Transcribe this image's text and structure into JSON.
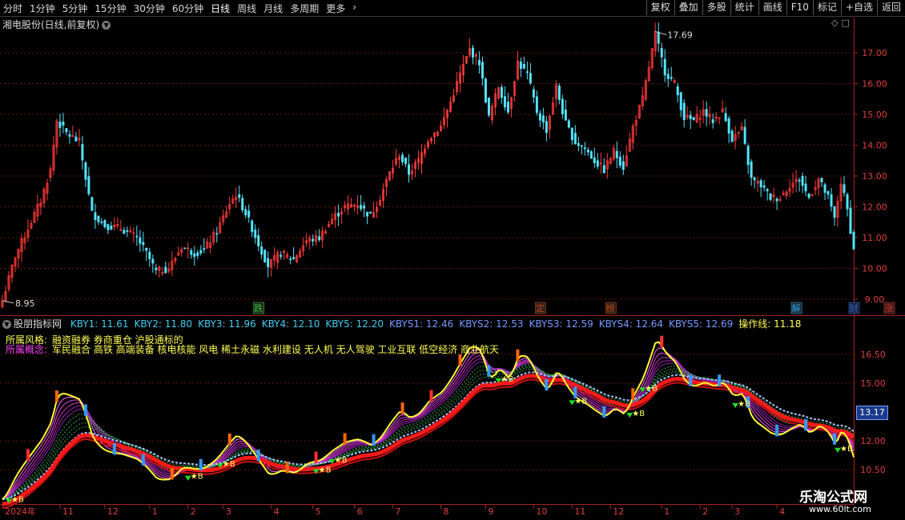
{
  "toolbar": {
    "periods": [
      "分时",
      "1分钟",
      "5分钟",
      "15分钟",
      "30分钟",
      "60分钟",
      "日线",
      "周线",
      "月线",
      "多周期",
      "更多"
    ],
    "active_period": "日线",
    "more_icon": "chevron-right-icon",
    "tools": [
      "复权",
      "叠加",
      "多股",
      "统计",
      "画线",
      "F10",
      "标记",
      "+自选",
      "返回"
    ]
  },
  "main_chart": {
    "title": "湘电股份(日线,前复权)",
    "high_label": "17.69",
    "low_label": "8.95",
    "price_ticks": [
      "17.00",
      "16.00",
      "15.00",
      "14.00",
      "13.00",
      "12.00",
      "11.00",
      "10.00",
      "9.00"
    ],
    "markers": [
      {
        "text": "跌",
        "x": 80,
        "color": "#33cc33"
      },
      {
        "text": "定",
        "x": 168,
        "color": "#cc4400"
      },
      {
        "text": "榜",
        "x": 190,
        "color": "#cc4400"
      },
      {
        "text": "解",
        "x": 248,
        "color": "#22aaee"
      },
      {
        "text": "财",
        "x": 266,
        "color": "#2266ee"
      },
      {
        "text": "涨",
        "x": 277,
        "color": "#ee2222"
      }
    ]
  },
  "indicator": {
    "name": "股朋指标网",
    "values": [
      {
        "text": "KBY1: 11.61",
        "color": "#44ccee"
      },
      {
        "text": "KBY2: 11.80",
        "color": "#44ccee"
      },
      {
        "text": "KBY3: 11.96",
        "color": "#44ccee"
      },
      {
        "text": "KBY4: 12.10",
        "color": "#44ccee"
      },
      {
        "text": "KBY5: 12.20",
        "color": "#44ccee"
      },
      {
        "text": "KBYS1: 12.46",
        "color": "#7799ff"
      },
      {
        "text": "KBYS2: 12.53",
        "color": "#7799ff"
      },
      {
        "text": "KBYS3: 12.59",
        "color": "#7799ff"
      },
      {
        "text": "KBYS4: 12.64",
        "color": "#7799ff"
      },
      {
        "text": "KBYS5: 12.69",
        "color": "#7799ff"
      },
      {
        "text": "操作线: 11.18",
        "color": "#ffff55"
      }
    ],
    "style_label": "所属风格:",
    "style_text": "融资融券 券商重仓 沪股通标的",
    "concept_label": "所属概念:",
    "concept_text": "军民融合 高铁 高端装备 核电核能 风电 稀土永磁 水利建设 无人机 无人驾驶 工业互联 低空经济 商业航天",
    "price_ticks": [
      "16.50",
      "15.00",
      "12.00",
      "10.50"
    ],
    "current_price": "13.17"
  },
  "x_axis": {
    "labels": [
      {
        "text": "2024年",
        "x": 0
      },
      {
        "text": "11",
        "x": 18
      },
      {
        "text": "12",
        "x": 32
      },
      {
        "text": "1",
        "x": 46
      },
      {
        "text": "2",
        "x": 58
      },
      {
        "text": "3",
        "x": 69
      },
      {
        "text": "4",
        "x": 84
      },
      {
        "text": "5",
        "x": 97
      },
      {
        "text": "6",
        "x": 110
      },
      {
        "text": "7",
        "x": 122
      },
      {
        "text": "8",
        "x": 137
      },
      {
        "text": "9",
        "x": 151
      },
      {
        "text": "10",
        "x": 166
      },
      {
        "text": "11",
        "x": 178
      },
      {
        "text": "12",
        "x": 190
      },
      {
        "text": "1",
        "x": 206
      },
      {
        "text": "2",
        "x": 218
      },
      {
        "text": "3",
        "x": 228
      },
      {
        "text": "4",
        "x": 242
      }
    ]
  },
  "watermark": {
    "title": "乐淘公式网",
    "url": "www.60lt.com"
  },
  "chart_data": {
    "type": "candlestick",
    "title": "湘电股份(日线,前复权)",
    "ylim": [
      8.7,
      18.2
    ],
    "annotations": {
      "max": 17.69,
      "min": 8.95
    },
    "close_keyframes": [
      [
        0,
        8.95
      ],
      [
        4,
        10.4
      ],
      [
        8,
        11.3
      ],
      [
        12,
        12.2
      ],
      [
        15,
        13.2
      ],
      [
        17,
        14.8
      ],
      [
        20,
        14.4
      ],
      [
        24,
        14.1
      ],
      [
        28,
        11.8
      ],
      [
        32,
        11.4
      ],
      [
        37,
        11.3
      ],
      [
        42,
        11.0
      ],
      [
        45,
        10.5
      ],
      [
        48,
        9.9
      ],
      [
        52,
        10.0
      ],
      [
        56,
        10.7
      ],
      [
        60,
        10.5
      ],
      [
        63,
        10.6
      ],
      [
        67,
        11.2
      ],
      [
        71,
        12.1
      ],
      [
        73,
        12.4
      ],
      [
        76,
        11.8
      ],
      [
        80,
        10.8
      ],
      [
        83,
        10.1
      ],
      [
        87,
        10.5
      ],
      [
        91,
        10.3
      ],
      [
        95,
        10.9
      ],
      [
        99,
        11.0
      ],
      [
        103,
        11.6
      ],
      [
        107,
        12.0
      ],
      [
        111,
        12.1
      ],
      [
        115,
        11.7
      ],
      [
        118,
        12.3
      ],
      [
        121,
        13.1
      ],
      [
        124,
        13.7
      ],
      [
        127,
        13.1
      ],
      [
        130,
        13.5
      ],
      [
        133,
        14.2
      ],
      [
        137,
        14.6
      ],
      [
        140,
        15.4
      ],
      [
        143,
        16.3
      ],
      [
        146,
        17.1
      ],
      [
        149,
        16.7
      ],
      [
        152,
        14.9
      ],
      [
        155,
        15.9
      ],
      [
        158,
        15.1
      ],
      [
        161,
        16.7
      ],
      [
        164,
        16.3
      ],
      [
        167,
        15.1
      ],
      [
        170,
        14.5
      ],
      [
        173,
        15.9
      ],
      [
        176,
        14.7
      ],
      [
        179,
        14.1
      ],
      [
        182,
        13.9
      ],
      [
        185,
        13.5
      ],
      [
        188,
        13.2
      ],
      [
        191,
        13.8
      ],
      [
        194,
        13.3
      ],
      [
        197,
        14.6
      ],
      [
        200,
        15.5
      ],
      [
        204,
        17.6
      ],
      [
        207,
        16.4
      ],
      [
        210,
        16.0
      ],
      [
        213,
        14.9
      ],
      [
        216,
        14.8
      ],
      [
        219,
        15.1
      ],
      [
        222,
        14.8
      ],
      [
        225,
        15.1
      ],
      [
        228,
        14.2
      ],
      [
        231,
        14.5
      ],
      [
        234,
        12.9
      ],
      [
        237,
        12.7
      ],
      [
        240,
        12.3
      ],
      [
        243,
        12.3
      ],
      [
        246,
        12.7
      ],
      [
        249,
        12.9
      ],
      [
        252,
        12.3
      ],
      [
        255,
        12.9
      ],
      [
        258,
        12.3
      ],
      [
        260,
        11.6
      ],
      [
        262,
        12.8
      ],
      [
        264,
        11.9
      ],
      [
        266,
        10.6
      ]
    ],
    "bars": 267,
    "indicator": {
      "series": [
        {
          "name": "KBY1",
          "last": 11.61
        },
        {
          "name": "KBY2",
          "last": 11.8
        },
        {
          "name": "KBY3",
          "last": 11.96
        },
        {
          "name": "KBY4",
          "last": 12.1
        },
        {
          "name": "KBY5",
          "last": 12.2
        },
        {
          "name": "KBYS1",
          "last": 12.46
        },
        {
          "name": "KBYS2",
          "last": 12.53
        },
        {
          "name": "KBYS3",
          "last": 12.59
        },
        {
          "name": "KBYS4",
          "last": 12.64
        },
        {
          "name": "KBYS5",
          "last": 12.69
        },
        {
          "name": "操作线",
          "last": 11.18
        }
      ],
      "ylim": [
        9.9,
        17.6
      ],
      "buy_marker_text": "★B",
      "buy_signals": [
        2,
        58,
        68,
        98,
        103,
        155,
        178,
        196,
        200,
        229,
        261
      ]
    }
  }
}
